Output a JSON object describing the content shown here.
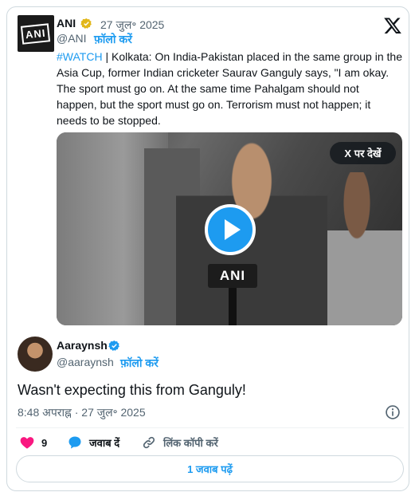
{
  "quoted_tweet": {
    "author_name": "ANI",
    "avatar_label": "ANI",
    "date": "27 जुल॰ 2025",
    "handle": "@ANI",
    "follow_label": "फ़ॉलो करें",
    "hashtag": "#WATCH",
    "text": " | Kolkata: On India-Pakistan placed in the same group in the Asia Cup, former Indian cricketer Saurav Ganguly says, \"I am okay. The sport must go on. At the same time Pahalgam should not happen, but the sport must go on. Terrorism must not happen; it needs to be stopped.",
    "video": {
      "watch_on_x_label": "X पर देखें",
      "mic_label": "ANI"
    }
  },
  "main_tweet": {
    "author_name": "Aaraynsh",
    "handle": "@aaraynsh",
    "follow_label": "फ़ॉलो करें",
    "text": "Wasn't expecting this from Ganguly!",
    "timestamp": "8:48 अपराह्न · 27 जुल॰ 2025"
  },
  "actions": {
    "like_count": "9",
    "reply_label": "जवाब दें",
    "copy_link_label": "लिंक कॉपी करें",
    "read_replies_label": "1 जवाब पढ़ें"
  },
  "colors": {
    "accent": "#1d9bf0",
    "like": "#f91880",
    "gold_badge": "#e2b719",
    "muted_text": "#536471"
  }
}
